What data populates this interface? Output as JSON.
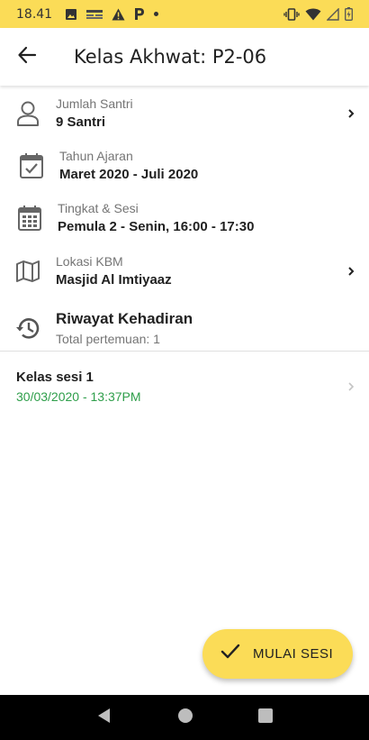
{
  "status_bar": {
    "time": "18.41",
    "icons": [
      "image-icon",
      "news-icon",
      "warning-icon",
      "parking-icon",
      "dot-icon",
      "vibrate-icon",
      "wifi-icon",
      "signal-icon",
      "battery-icon"
    ],
    "background": "#fbdc57"
  },
  "app_bar": {
    "title": "Kelas Akhwat: P2-06",
    "back_icon": "arrow-left-icon"
  },
  "info": [
    {
      "icon": "person-icon",
      "label": "Jumlah Santri",
      "value": "9 Santri",
      "has_chevron": true
    },
    {
      "icon": "calendar-check-icon",
      "label": "Tahun Ajaran",
      "value": "Maret 2020 - Juli 2020",
      "has_chevron": false
    },
    {
      "icon": "calendar-grid-icon",
      "label": "Tingkat & Sesi",
      "value": "Pemula 2 - Senin, 16:00 - 17:30",
      "has_chevron": false
    },
    {
      "icon": "map-icon",
      "label": "Lokasi KBM",
      "value": "Masjid Al Imtiyaaz",
      "has_chevron": true
    }
  ],
  "history": {
    "icon": "history-icon",
    "title": "Riwayat Kehadiran",
    "subtitle": "Total pertemuan: 1"
  },
  "sessions": [
    {
      "title": "Kelas sesi 1",
      "datetime": "30/03/2020 - 13:37PM"
    }
  ],
  "fab": {
    "label": "MULAI SESI",
    "icon": "check-icon",
    "color": "#fbdc57"
  },
  "colors": {
    "accent": "#fbdc57",
    "date_green": "#2e9e4a",
    "label_gray": "#757575"
  }
}
